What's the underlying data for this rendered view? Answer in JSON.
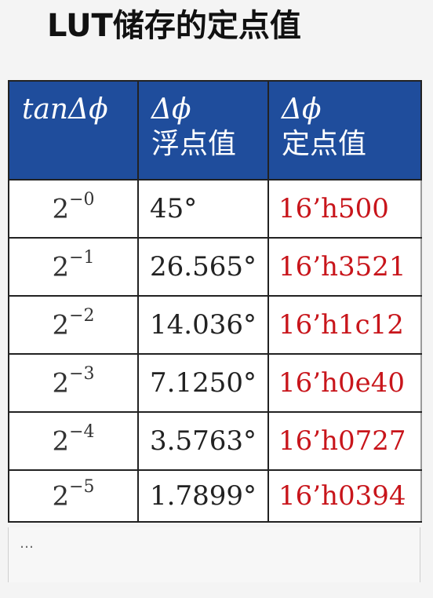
{
  "title": "LUT储存的定点值",
  "table": {
    "headers": [
      {
        "symbol": "tanΔϕ",
        "sub": ""
      },
      {
        "symbol": "Δϕ",
        "sub": "浮点值"
      },
      {
        "symbol": "Δϕ",
        "sub": "定点值"
      }
    ],
    "rows": [
      {
        "tan_base": "2",
        "tan_exp": "−0",
        "float": "45°",
        "fixed": "16’h500"
      },
      {
        "tan_base": "2",
        "tan_exp": "−1",
        "float": "26.565°",
        "fixed": "16’h3521"
      },
      {
        "tan_base": "2",
        "tan_exp": "−2",
        "float": "14.036°",
        "fixed": "16’h1c12"
      },
      {
        "tan_base": "2",
        "tan_exp": "−3",
        "float": "7.1250°",
        "fixed": "16’h0e40"
      },
      {
        "tan_base": "2",
        "tan_exp": "−4",
        "float": "3.5763°",
        "fixed": "16’h0727"
      },
      {
        "tan_base": "2",
        "tan_exp": "−5",
        "float": "1.7899°",
        "fixed": "16’h0394"
      }
    ],
    "ellipsis": "…"
  },
  "colors": {
    "header_bg": "#1f4d9c",
    "header_text": "#ffffff",
    "fixed_value_text": "#c8151b",
    "border": "#222222"
  }
}
